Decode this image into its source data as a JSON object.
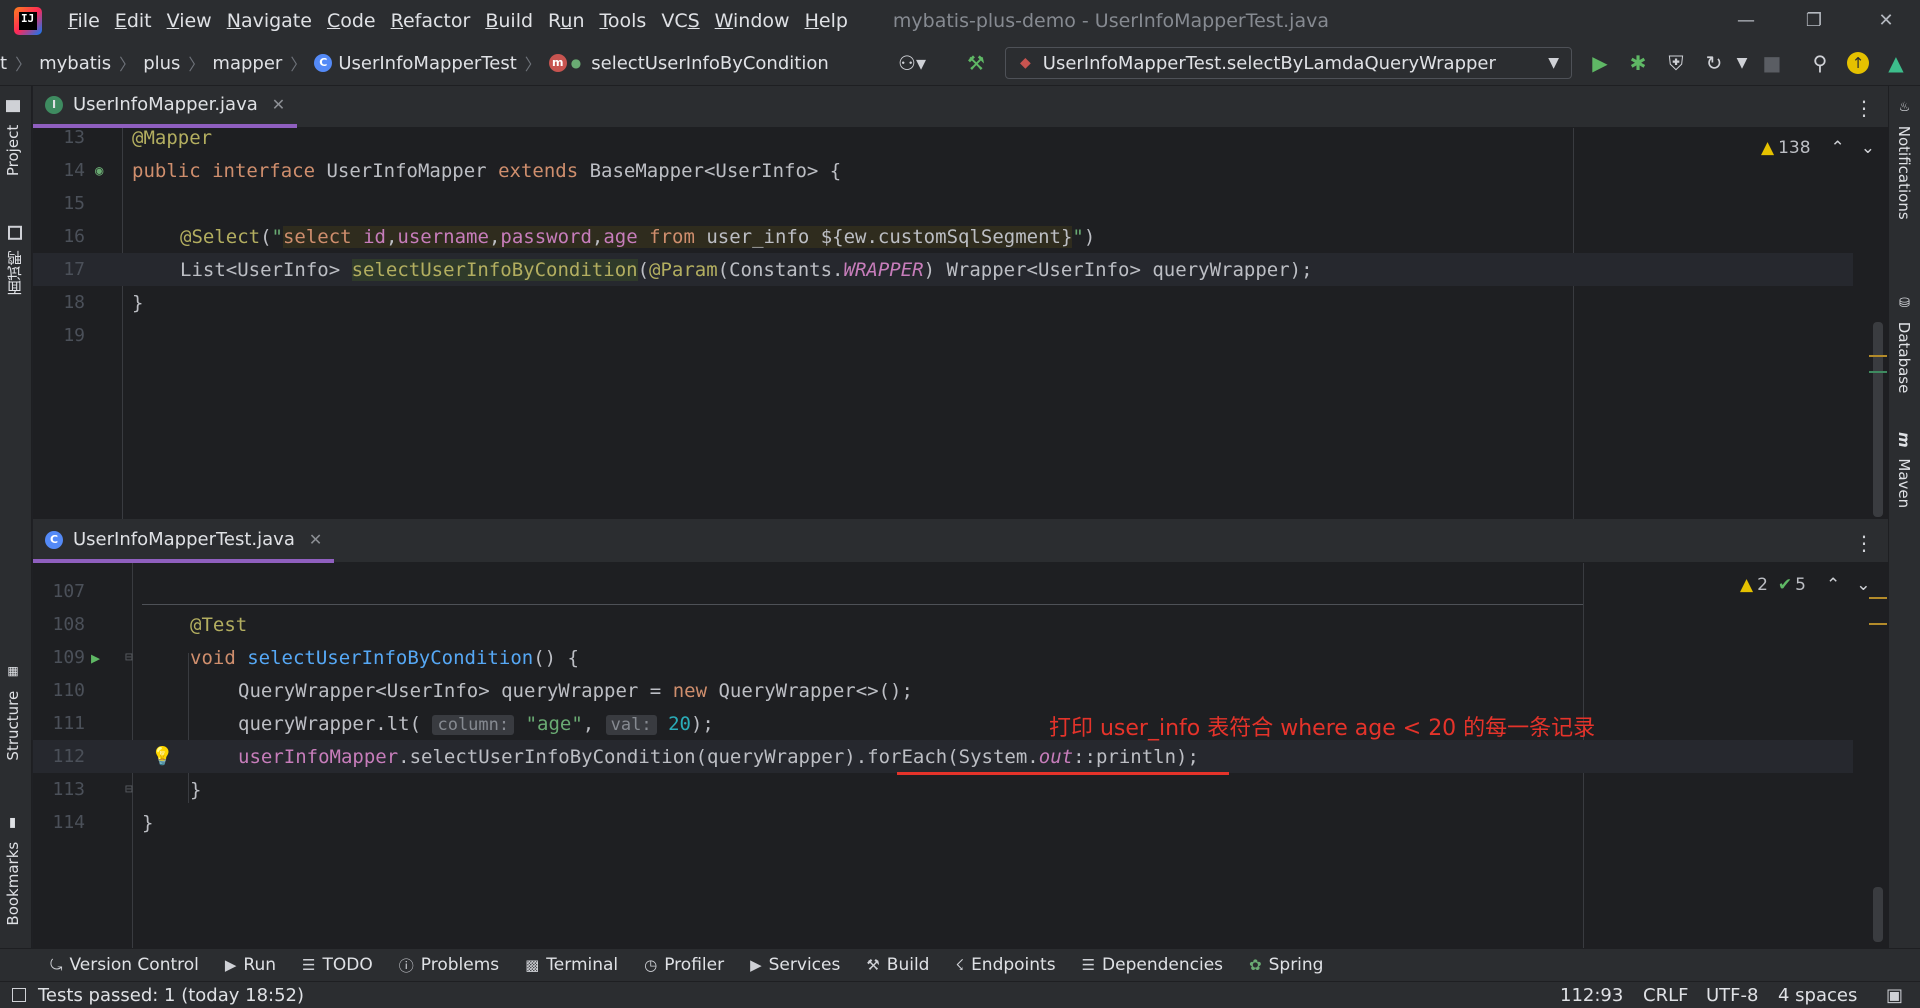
{
  "titlebar": {
    "menus": [
      "File",
      "Edit",
      "View",
      "Navigate",
      "Code",
      "Refactor",
      "Build",
      "Run",
      "Tools",
      "VCS",
      "Window",
      "Help"
    ],
    "mnemonics": [
      "F",
      "E",
      "V",
      "N",
      "C",
      "R",
      "B",
      "u",
      "T",
      "S",
      "W",
      "H"
    ],
    "window_title": "mybatis-plus-demo - UserInfoMapperTest.java"
  },
  "breadcrumb": {
    "items": [
      "t",
      "mybatis",
      "plus",
      "mapper",
      "UserInfoMapperTest",
      "selectUserInfoByCondition"
    ]
  },
  "run_config": {
    "label": "UserInfoMapperTest.selectByLamdaQueryWrapper"
  },
  "left_tools": {
    "project": "Project",
    "interview": "面试鸭",
    "structure": "Structure",
    "bookmarks": "Bookmarks"
  },
  "right_tools": {
    "notifications": "Notifications",
    "database": "Database",
    "maven": "Maven"
  },
  "top_editor": {
    "tab_label": "UserInfoMapper.java",
    "warnings": "138",
    "lines": [
      {
        "num": "13"
      },
      {
        "num": "14"
      },
      {
        "num": "15"
      },
      {
        "num": "16"
      },
      {
        "num": "17"
      },
      {
        "num": "18"
      },
      {
        "num": "19"
      }
    ]
  },
  "bottom_editor": {
    "tab_label": "UserInfoMapperTest.java",
    "warnings": "2",
    "oks": "5",
    "lines": [
      {
        "num": "107"
      },
      {
        "num": "108"
      },
      {
        "num": "109"
      },
      {
        "num": "110"
      },
      {
        "num": "111"
      },
      {
        "num": "112"
      },
      {
        "num": "113"
      },
      {
        "num": "114"
      }
    ],
    "annotation_note": "打印 user_info 表符合 where age < 20 的每一条记录"
  },
  "tool_windows": [
    "Version Control",
    "Run",
    "TODO",
    "Problems",
    "Terminal",
    "Profiler",
    "Services",
    "Build",
    "Endpoints",
    "Dependencies",
    "Spring"
  ],
  "status": {
    "message": "Tests passed: 1 (today 18:52)",
    "position": "112:93",
    "line_sep": "CRLF",
    "encoding": "UTF-8",
    "indent": "4 spaces"
  },
  "colors": {
    "accent_tab": "#8f5fbf",
    "red_note": "#e5332a",
    "run_green": "#5fb865"
  }
}
